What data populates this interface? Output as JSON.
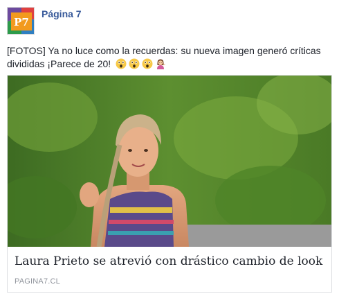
{
  "page": {
    "name": "Página 7",
    "avatar_text": "P7"
  },
  "post": {
    "text": "[FOTOS] Ya no luce como la recuerdas: su nueva imagen generó críticas divididas ¡Parece de 20!",
    "emojis": [
      "astonished-face",
      "astonished-face",
      "astonished-face",
      "person-tipping-hand"
    ]
  },
  "link": {
    "title": "Laura Prieto se atrevió con drástico cambio de look",
    "domain": "PAGINA7.CL"
  },
  "colors": {
    "page_name": "#365899",
    "text": "#1d2129",
    "meta": "#90949c",
    "border": "#dddfe2",
    "avatar_orange": "#f29a1e"
  }
}
